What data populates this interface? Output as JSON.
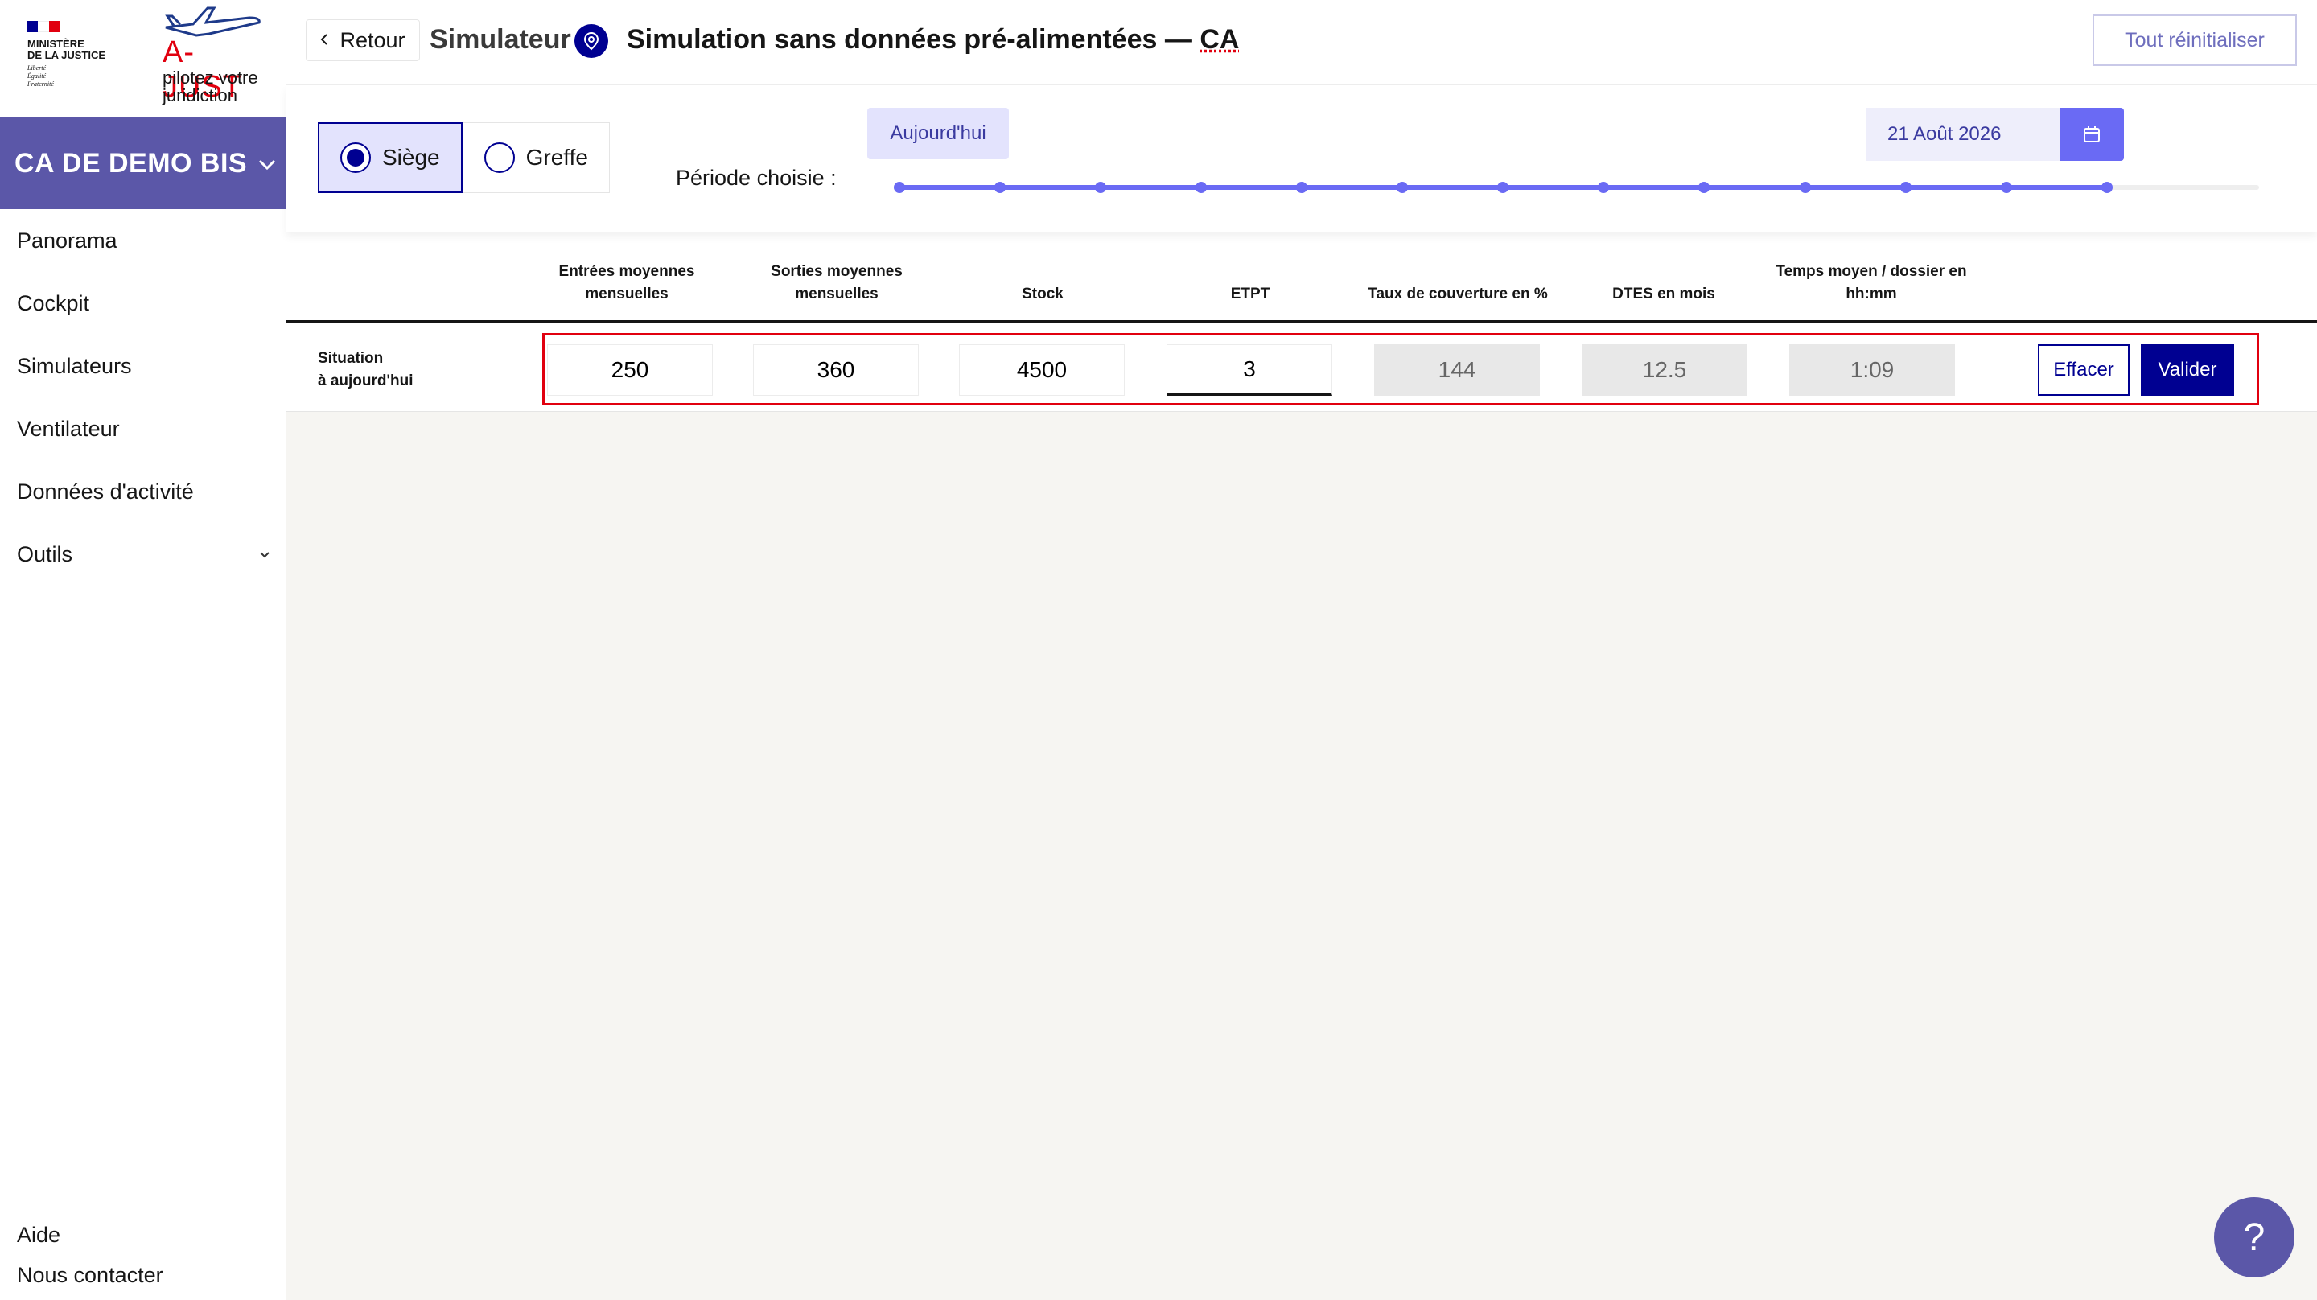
{
  "sidebar": {
    "ministry": {
      "name_line1": "MINISTÈRE",
      "name_line2": "DE LA JUSTICE",
      "motto_line1": "Liberté",
      "motto_line2": "Égalité",
      "motto_line3": "Fraternité",
      "flag_colors": [
        "#000091",
        "#ffffff",
        "#e1000f"
      ]
    },
    "app_logo": {
      "title": "A-JUST",
      "subtitle_line1": "pilotez votre",
      "subtitle_line2": "juridiction"
    },
    "court": {
      "name": "CA DE DEMO BIS",
      "icon": "chevron-down-icon"
    },
    "nav": [
      {
        "label": "Panorama"
      },
      {
        "label": "Cockpit"
      },
      {
        "label": "Simulateurs"
      },
      {
        "label": "Ventilateur"
      },
      {
        "label": "Données d'activité"
      },
      {
        "label": "Outils",
        "icon": "chevron-down-icon"
      }
    ],
    "bottom": {
      "help": "Aide",
      "contact": "Nous contacter"
    }
  },
  "header": {
    "back_label": "Retour",
    "section": "Simulateur",
    "title_main": "Simulation sans données pré-alimentées — ",
    "title_suffix": "CA",
    "reset_label": "Tout réinitialiser",
    "pin_icon": "map-pin-icon"
  },
  "period": {
    "fonctions": [
      {
        "label": "Siège",
        "selected": true
      },
      {
        "label": "Greffe",
        "selected": false
      }
    ],
    "label": "Période choisie :",
    "start_label": "Aujourd'hui",
    "end_date": "21 Août 2026",
    "calendar_icon": "calendar-icon",
    "slider_ticks": 13,
    "slider_selected_fraction": 0.888
  },
  "table": {
    "columns": [
      {
        "line1": "Entrées moyennes",
        "line2": "mensuelles"
      },
      {
        "line1": "Sorties moyennes",
        "line2": "mensuelles"
      },
      {
        "line1": "",
        "line2": "Stock"
      },
      {
        "line1": "",
        "line2": "ETPT"
      },
      {
        "line1": "",
        "line2": "Taux de couverture en %"
      },
      {
        "line1": "",
        "line2": "DTES en mois"
      },
      {
        "line1": "Temps moyen / dossier en",
        "line2": "hh:mm"
      }
    ],
    "row": {
      "label_line1": "Situation",
      "label_line2": "à aujourd'hui",
      "values": [
        "250",
        "360",
        "4500",
        "3",
        "144",
        "12.5",
        "1:09"
      ]
    },
    "effacer_label": "Effacer",
    "valider_label": "Valider"
  },
  "help_fab": "?",
  "colors": {
    "primary_blue": "#000091",
    "accent_purple": "#6a6af4",
    "court_bg": "#5b57a8",
    "highlight_red": "#e1000f"
  }
}
